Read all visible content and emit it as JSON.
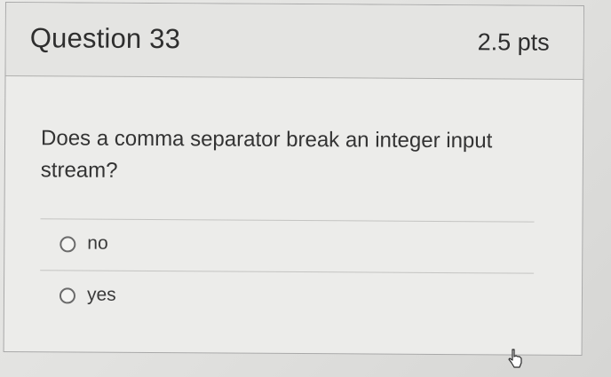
{
  "question": {
    "title": "Question 33",
    "points": "2.5 pts",
    "text": "Does a comma separator break an integer input stream?"
  },
  "answers": [
    {
      "label": "no",
      "selected": false
    },
    {
      "label": "yes",
      "selected": false
    }
  ],
  "cursor_icon": "pointer-cursor-icon",
  "colors": {
    "header_bg": "#e4e4e2",
    "body_bg": "#ececea",
    "text": "#2e2e2e",
    "border": "#a8a8a8"
  }
}
